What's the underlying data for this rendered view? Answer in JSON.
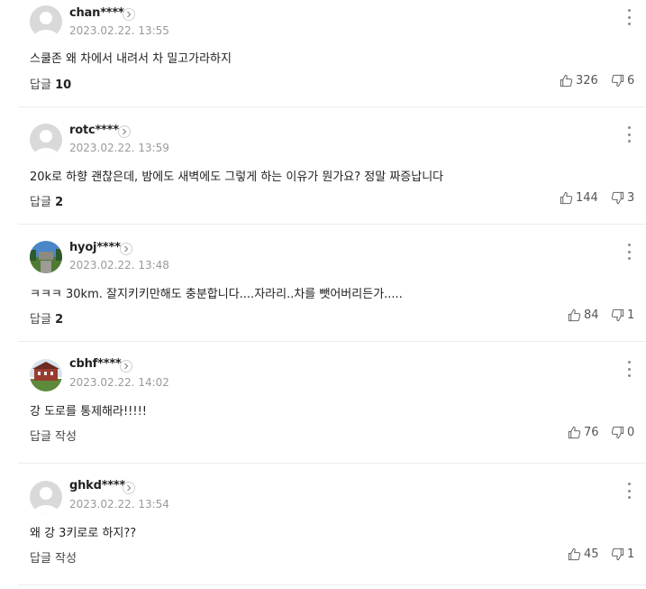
{
  "comments": [
    {
      "nick": "chan****",
      "date": "2023.02.22. 13:55",
      "text": "스쿨존 왜 차에서 내려서 차 밀고가라하지",
      "reply_label": "답글",
      "reply_count": "10",
      "likes": "326",
      "dislikes": "6",
      "avatar": "default"
    },
    {
      "nick": "rotc****",
      "date": "2023.02.22. 13:59",
      "text": "20k로 하향 괜찮은데, 밤에도 새벽에도 그렇게 하는 이유가 뭔가요? 정말 짜증납니다",
      "reply_label": "답글",
      "reply_count": "2",
      "likes": "144",
      "dislikes": "3",
      "avatar": "default"
    },
    {
      "nick": "hyoj****",
      "date": "2023.02.22. 13:48",
      "text": "ㅋㅋㅋ 30km. 잘지키키만해도 충분합니다....자라리..차를 뺏어버리든가.....",
      "reply_label": "답글",
      "reply_count": "2",
      "likes": "84",
      "dislikes": "1",
      "avatar": "landscape"
    },
    {
      "nick": "cbhf****",
      "date": "2023.02.22. 14:02",
      "text": "강 도로를 통제해라!!!!!",
      "reply_label": "답글 작성",
      "reply_count": "",
      "likes": "76",
      "dislikes": "0",
      "avatar": "building"
    },
    {
      "nick": "ghkd****",
      "date": "2023.02.22. 13:54",
      "text": "왜 강 3키로로 하지??",
      "reply_label": "답글 작성",
      "reply_count": "",
      "likes": "45",
      "dislikes": "1",
      "avatar": "default"
    }
  ],
  "icons": {
    "like": "thumbs-up-icon",
    "dislike": "thumbs-down-icon",
    "more": "more-vertical-icon",
    "profile": "chevron-right-icon"
  },
  "colors": {
    "text": "#222222",
    "date": "#9a9a9a",
    "divider": "#ececec"
  }
}
